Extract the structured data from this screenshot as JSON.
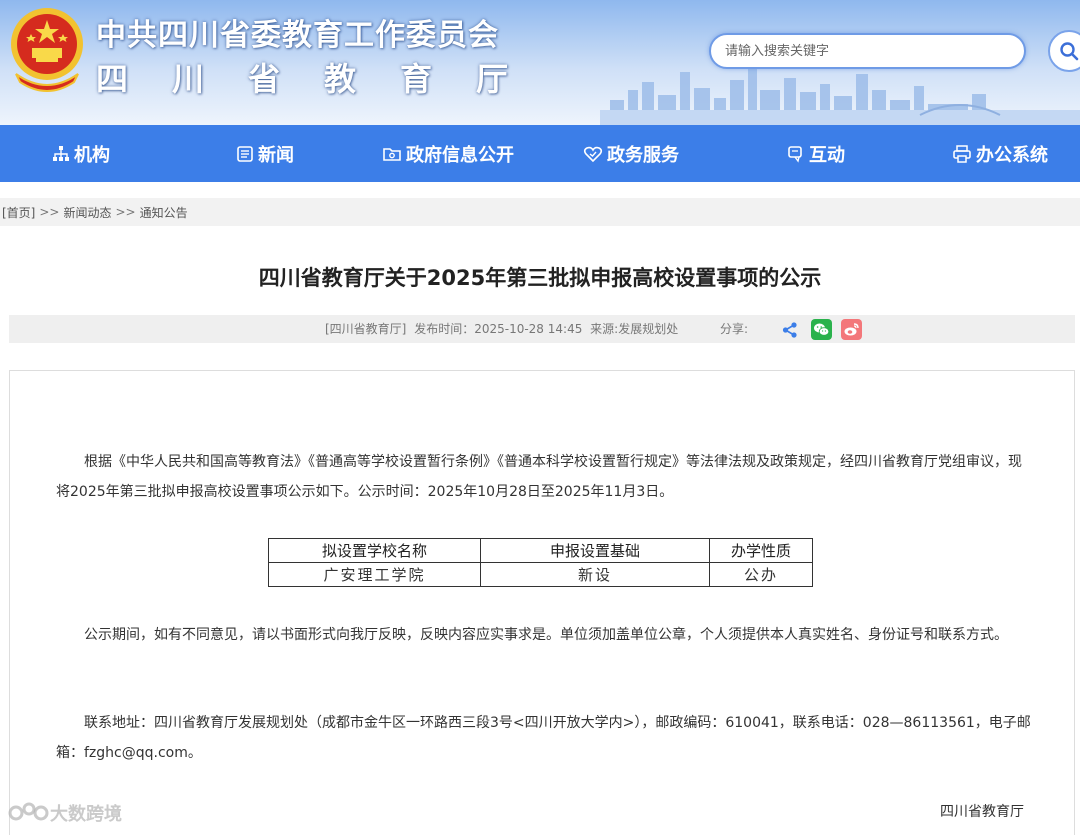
{
  "header": {
    "title_1": "中共四川省委教育工作委员会",
    "title_2": "四川省教育厅",
    "search_placeholder": "请输入搜索关键字",
    "emblem": "national-emblem",
    "search_icon": "search-icon"
  },
  "nav": {
    "items": [
      {
        "label": "机构",
        "icon": "organization-icon"
      },
      {
        "label": "新闻",
        "icon": "news-icon"
      },
      {
        "label": "政府信息公开",
        "icon": "folder-icon"
      },
      {
        "label": "政务服务",
        "icon": "service-heart-icon"
      },
      {
        "label": "互动",
        "icon": "interaction-icon"
      },
      {
        "label": "办公系统",
        "icon": "printer-icon"
      }
    ]
  },
  "breadcrumb": {
    "home": "[首页]",
    "sep": ">>",
    "level1": "新闻动态",
    "level2": "通知公告"
  },
  "article": {
    "title": "四川省教育厅关于2025年第三批拟申报高校设置事项的公示",
    "meta": {
      "source": "[四川省教育厅]",
      "publish_time": "发布时间：2025-10-28 14:45",
      "origin": "来源:发展规划处",
      "share_label": "分享:"
    },
    "paragraph_1": "根据《中华人民共和国高等教育法》《普通高等学校设置暂行条例》《普通本科学校设置暂行规定》等法律法规及政策规定，经四川省教育厅党组审议，现将2025年第三批拟申报高校设置事项公示如下。公示时间：2025年10月28日至2025年11月3日。",
    "table": {
      "headers": [
        "拟设置学校名称",
        "申报设置基础",
        "办学性质"
      ],
      "rows": [
        [
          "广安理工学院",
          "新设",
          "公办"
        ]
      ]
    },
    "paragraph_2": "公示期间，如有不同意见，请以书面形式向我厅反映，反映内容应实事求是。单位须加盖单位公章，个人须提供本人真实姓名、身份证号和联系方式。",
    "paragraph_3": "联系地址：四川省教育厅发展规划处（成都市金牛区一环路西三段3号<四川开放大学内>），邮政编码：610041，联系电话：028—86113561，电子邮箱：fzghc@qq.com。",
    "signature": "四川省教育厅"
  },
  "watermark": "大数跨境",
  "colors": {
    "nav_bg": "#3c7ee8",
    "wechat": "#2ab24c",
    "weibo": "#f3777a",
    "share": "#3c7ee8"
  }
}
